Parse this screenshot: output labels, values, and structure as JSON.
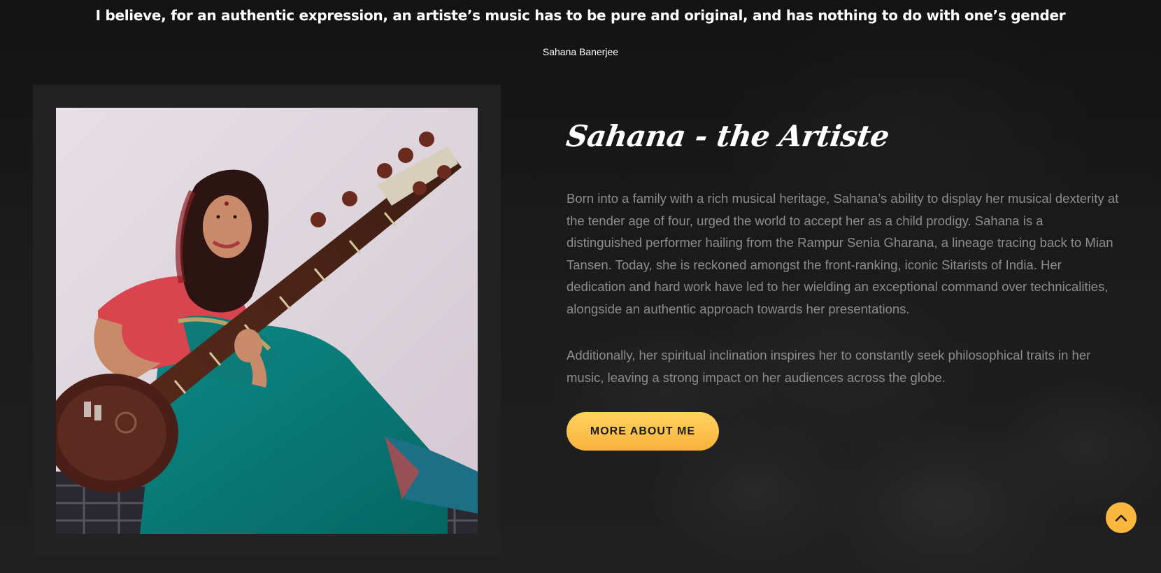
{
  "quote": {
    "text": "I believe, for an authentic expression, an artiste’s music has to be pure and original, and has nothing to do with one’s gender",
    "author": "Sahana Banerjee"
  },
  "about": {
    "title": "Sahana - the Artiste",
    "paragraphs": [
      "Born into a family with a rich musical heritage, Sahana’s ability to display her musical dexterity at the tender age of four, urged the world to accept her as a child prodigy. Sahana is a distinguished performer hailing from the Rampur Senia Gharana, a lineage tracing back to Mian Tansen. Today, she is reckoned amongst the front-ranking, iconic Sitarists of India. Her dedication and hard work have led to her wielding an exceptional command over technicalities, alongside an authentic approach towards her presentations.",
      "Additionally, her spiritual inclination inspires her to constantly seek philosophical traits in her music, leaving a strong impact on her audiences across the globe."
    ],
    "button_label": "More About Me"
  },
  "icons": {
    "scroll_top": "chevron-up-icon"
  },
  "colors": {
    "accent": "#fbb73e",
    "background": "#171717",
    "body_text": "#8d8d8d",
    "frame": "#222222"
  }
}
